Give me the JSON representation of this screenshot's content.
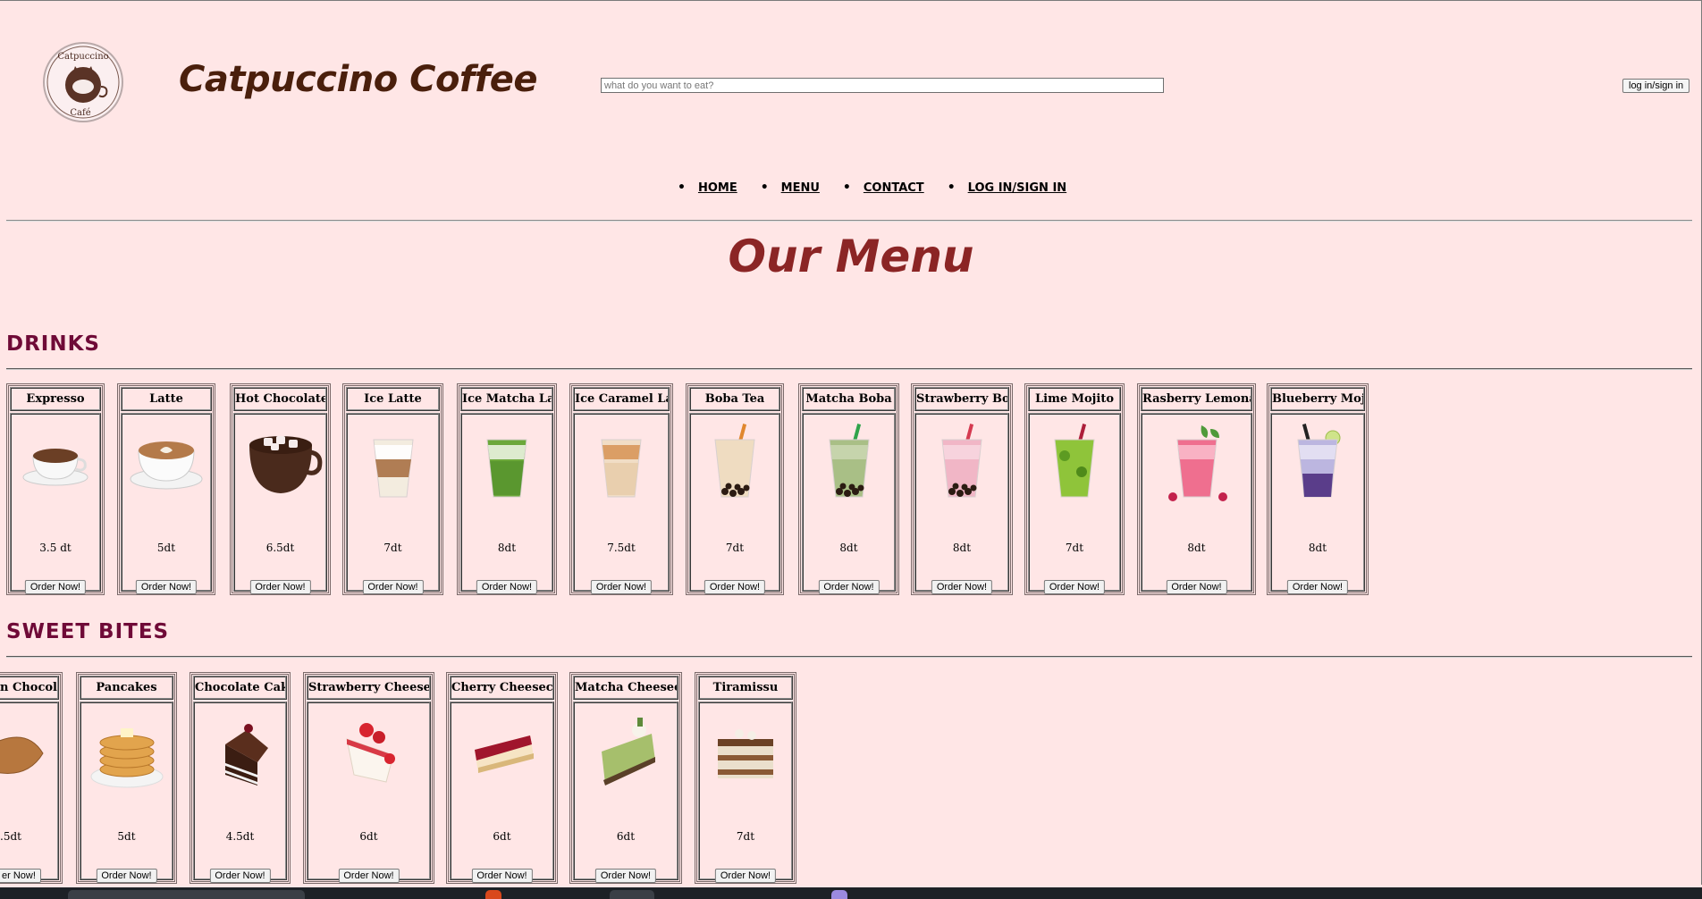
{
  "header": {
    "logo_alt": "Catpuccino Café",
    "logo_top_text": "Catpuccino",
    "logo_bottom_text": "Café",
    "site_title": "Catpuccino Coffee",
    "search_placeholder": "what do you want to eat?",
    "login_button": "log in/sign in"
  },
  "nav": [
    "HOME",
    "MENU",
    "CONTACT",
    "LOG IN/SIGN IN"
  ],
  "page_title": "Our Menu",
  "sections": [
    {
      "title": "DRINKS",
      "items": [
        {
          "name": "Expresso",
          "price": "3.5 dt",
          "img": "espresso"
        },
        {
          "name": "Latte",
          "price": "5dt",
          "img": "latte"
        },
        {
          "name": "Hot Chocolate",
          "price": "6.5dt",
          "img": "hot-chocolate"
        },
        {
          "name": "Ice Latte",
          "price": "7dt",
          "img": "ice-latte"
        },
        {
          "name": "Ice Matcha Latte",
          "price": "8dt",
          "img": "matcha"
        },
        {
          "name": "Ice Caramel Latte",
          "price": "7.5dt",
          "img": "caramel"
        },
        {
          "name": "Boba Tea",
          "price": "7dt",
          "img": "boba"
        },
        {
          "name": "Matcha Boba",
          "price": "8dt",
          "img": "matcha-boba"
        },
        {
          "name": "Strawberry Boba",
          "price": "8dt",
          "img": "strawberry-boba"
        },
        {
          "name": "Lime Mojito",
          "price": "7dt",
          "img": "lime-mojito"
        },
        {
          "name": "Rasberry Lemonade",
          "price": "8dt",
          "img": "raspberry"
        },
        {
          "name": "Blueberry Mojito",
          "price": "8dt",
          "img": "blueberry"
        }
      ]
    },
    {
      "title": "SWEET BITES",
      "items": [
        {
          "name": "n Chocolat",
          "price": ".5dt",
          "img": "croissant",
          "order_label": "er Now!"
        },
        {
          "name": "Pancakes",
          "price": "5dt",
          "img": "pancakes"
        },
        {
          "name": "Chocolate Cake",
          "price": "4.5dt",
          "img": "choc-cake"
        },
        {
          "name": "Strawberry Cheesecake",
          "price": "6dt",
          "img": "strawberry-cheesecake"
        },
        {
          "name": "Cherry Cheesecake",
          "price": "6dt",
          "img": "cherry-cheesecake"
        },
        {
          "name": "Matcha Cheesecake",
          "price": "6dt",
          "img": "matcha-cheesecake"
        },
        {
          "name": "Tiramissu",
          "price": "7dt",
          "img": "tiramisu"
        }
      ]
    }
  ],
  "order_button_label": "Order Now!",
  "colors": {
    "background": "#ffe6e6",
    "title_brown": "#4a1f0c",
    "menu_title_red": "#8b2525",
    "section_title": "#6f0a37"
  }
}
